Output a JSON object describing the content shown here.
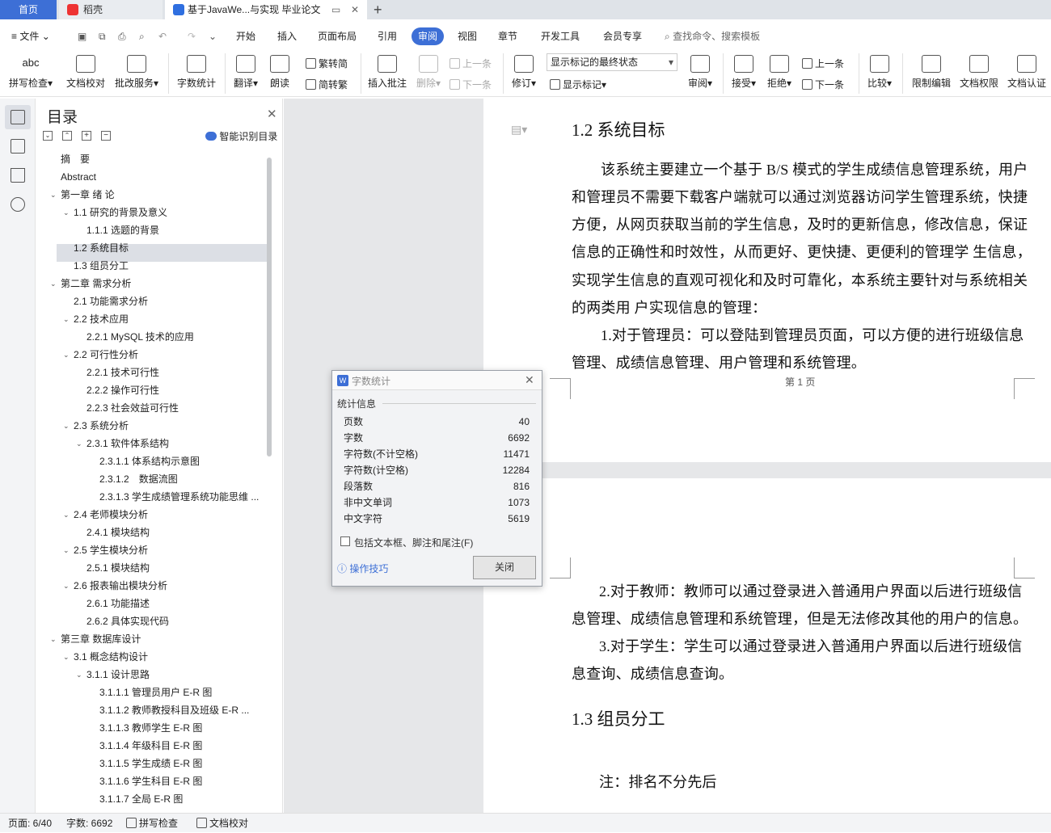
{
  "tabs": {
    "home": "首页",
    "wps": "稻壳",
    "doc": "基于JavaWe...与实现 毕业论文"
  },
  "quickbar": {
    "file": "文件"
  },
  "menu": [
    "开始",
    "插入",
    "页面布局",
    "引用",
    "审阅",
    "视图",
    "章节",
    "开发工具",
    "会员专享"
  ],
  "search_placeholder": "查找命令、搜索模板",
  "ribbon": {
    "spellcheck": "拼写检查",
    "proofread": "文档校对",
    "batch_service": "批改服务",
    "word_count": "字数统计",
    "translate": "翻译",
    "read_aloud": "朗读",
    "to_traditional": "繁转简",
    "to_simplified": "简转繁",
    "insert_comment": "插入批注",
    "delete": "删除",
    "prev_comment": "上一条",
    "next_comment": "下一条",
    "revise": "修订",
    "markup_state": "显示标记的最终状态",
    "show_markup": "显示标记",
    "review": "审阅",
    "accept": "接受",
    "reject": "拒绝",
    "prev": "上一条",
    "next": "下一条",
    "compare": "比较",
    "restrict_edit": "限制编辑",
    "doc_permission": "文档权限",
    "doc_cert": "文档认证"
  },
  "toc": {
    "title": "目录",
    "smart": "智能识别目录",
    "items": [
      "摘　要",
      "Abstract",
      "第一章 绪 论",
      "1.1 研究的背景及意义",
      "1.1.1 选题的背景",
      "1.2 系统目标",
      "1.3 组员分工",
      "第二章 需求分析",
      "2.1 功能需求分析",
      "2.2 技术应用",
      "2.2.1 MySQL 技术的应用",
      "2.2 可行性分析",
      "2.2.1 技术可行性",
      "2.2.2 操作可行性",
      "2.2.3 社会效益可行性",
      "2.3 系统分析",
      "2.3.1 软件体系结构",
      "2.3.1.1 体系结构示意图",
      "2.3.1.2　数据流图",
      "2.3.1.3 学生成绩管理系统功能思维 ...",
      "2.4 老师模块分析",
      "2.4.1 模块结构",
      "2.5 学生模块分析",
      "2.5.1 模块结构",
      "2.6 报表输出模块分析",
      "2.6.1 功能描述",
      "2.6.2 具体实现代码",
      "第三章 数据库设计",
      "3.1 概念结构设计",
      "3.1.1 设计思路",
      "3.1.1.1 管理员用户 E-R 图",
      "3.1.1.2 教师教授科目及班级 E-R ...",
      "3.1.1.3 教师学生 E-R 图",
      "3.1.1.4 年级科目 E-R 图",
      "3.1.1.5 学生成绩 E-R 图",
      "3.1.1.6 学生科目 E-R 图",
      "3.1.1.7 全局 E-R 图"
    ]
  },
  "document": {
    "h12": "1.2 系统目标",
    "p1": [
      "该系统主要建立一个基于 B/S 模式的学生成绩信息管理系统，用户",
      "和管理员不需要下载客户端就可以通过浏览器访问学生管理系统，快捷",
      "方便，从网页获取当前的学生信息，及时的更新信息，修改信息，保证",
      "信息的正确性和时效性，从而更好、更快捷、更便利的管理学 生信息，",
      "实现学生信息的直观可视化和及时可靠化，本系统主要针对与系统相关",
      "的两类用 户实现信息的管理："
    ],
    "p2": [
      "1.对于管理员：可以登陆到管理员页面，可以方便的进行班级信息",
      "管理、成绩信息管理、用户管理和系统管理。"
    ],
    "page_footer": "第 1 页",
    "p3": [
      "2.对于教师：教师可以通过登录进入普通用户界面以后进行班级信",
      "息管理、成绩信息管理和系统管理，但是无法修改其他的用户的信息。"
    ],
    "p4": [
      "3.对于学生：学生可以通过登录进入普通用户界面以后进行班级信",
      "息查询、成绩信息查询。"
    ],
    "h13": "1.3 组员分工",
    "note": "注：排名不分先后"
  },
  "dialog": {
    "title": "字数统计",
    "section": "统计信息",
    "rows": [
      [
        "页数",
        "40"
      ],
      [
        "字数",
        "6692"
      ],
      [
        "字符数(不计空格)",
        "11471"
      ],
      [
        "字符数(计空格)",
        "12284"
      ],
      [
        "段落数",
        "816"
      ],
      [
        "非中文单词",
        "1073"
      ],
      [
        "中文字符",
        "5619"
      ]
    ],
    "checkbox": "包括文本框、脚注和尾注(F)",
    "tips": "操作技巧",
    "close": "关闭"
  },
  "status": {
    "page": "页面: 6/40",
    "words": "字数: 6692",
    "spell": "拼写检查",
    "proof": "文档校对"
  },
  "colors": {
    "accent": "#3d6fd6",
    "toc_selected": "#dcdfe5"
  }
}
